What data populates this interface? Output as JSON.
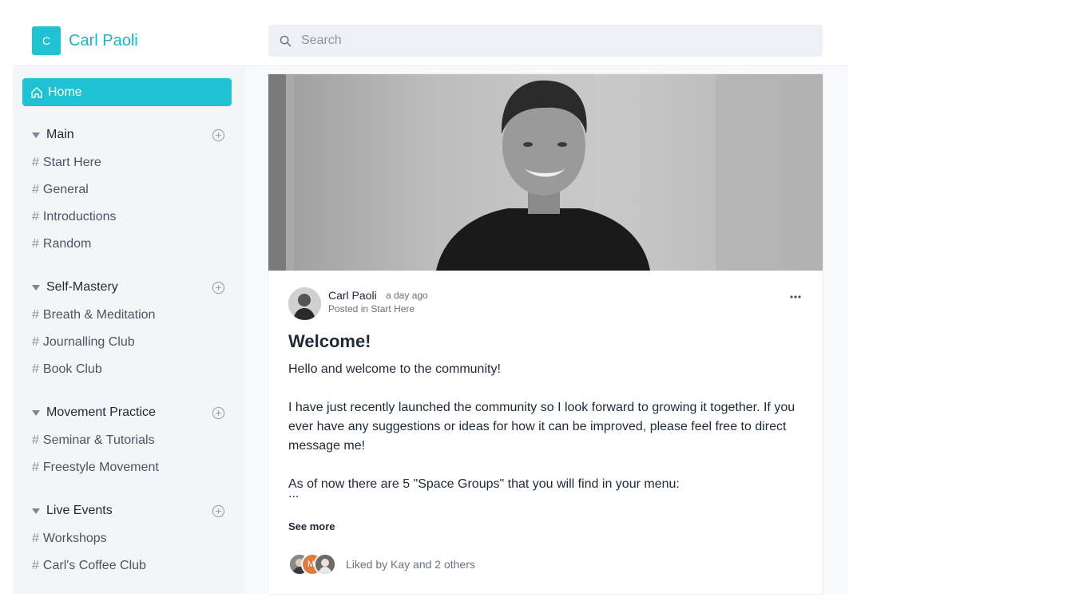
{
  "brand": {
    "initial": "C",
    "name": "Carl Paoli"
  },
  "search": {
    "placeholder": "Search"
  },
  "sidebar": {
    "home_label": "Home",
    "groups": [
      {
        "title": "Main",
        "channels": [
          "Start Here",
          "General",
          "Introductions",
          "Random"
        ]
      },
      {
        "title": "Self-Mastery",
        "channels": [
          "Breath & Meditation",
          "Journalling Club",
          "Book Club"
        ]
      },
      {
        "title": "Movement Practice",
        "channels": [
          "Seminar & Tutorials",
          "Freestyle Movement"
        ]
      },
      {
        "title": "Live Events",
        "channels": [
          "Workshops",
          "Carl's Coffee Club"
        ]
      }
    ]
  },
  "post": {
    "author": "Carl Paoli",
    "time": "a day ago",
    "posted_prefix": "Posted in",
    "space": "Start Here",
    "title": "Welcome!",
    "paragraphs": [
      "Hello and welcome to the community!",
      "I have just recently launched the community so I look forward to growing it together. If you ever have any suggestions or ideas for how it can be improved, please feel free to direct message me!",
      "As of now there are 5 \"Space Groups\" that you will find in your menu:"
    ],
    "ellipsis": "...",
    "see_more": "See more",
    "likers": [
      {
        "initials": "",
        "color": "#6b6b6b"
      },
      {
        "initials": "MI",
        "color": "#e07b3c"
      },
      {
        "initials": "",
        "color": "#555555"
      }
    ],
    "liked_text": "Liked by Kay and 2 others"
  },
  "colors": {
    "accent": "#1ec2d2",
    "brand_text": "#18b6c6"
  }
}
